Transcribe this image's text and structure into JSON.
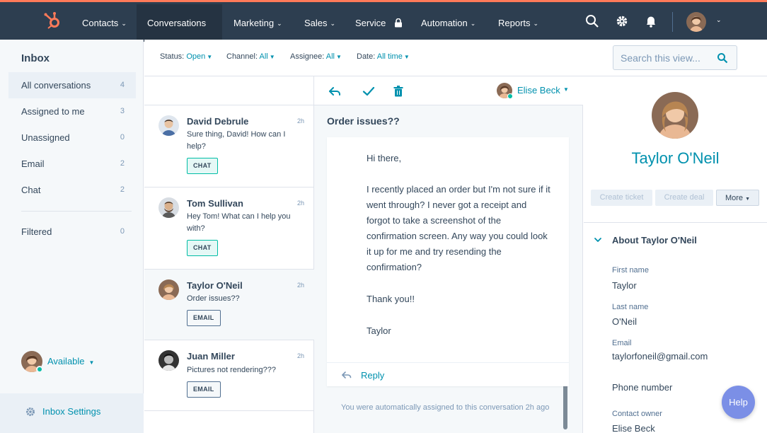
{
  "nav": {
    "items": [
      {
        "label": "Contacts",
        "has_chevron": true
      },
      {
        "label": "Conversations",
        "has_chevron": true,
        "active": true
      },
      {
        "label": "Marketing",
        "has_chevron": true
      },
      {
        "label": "Sales",
        "has_chevron": true
      },
      {
        "label": "Service",
        "locked": true
      },
      {
        "label": "Automation",
        "has_chevron": true
      },
      {
        "label": "Reports",
        "has_chevron": true
      }
    ],
    "icons": [
      "search-icon",
      "gear-icon",
      "bell-icon"
    ],
    "accent": "#ff7a59",
    "background": "#2d3e50"
  },
  "sidebar": {
    "title": "Inbox",
    "items": [
      {
        "label": "All conversations",
        "count": "4",
        "active": true
      },
      {
        "label": "Assigned to me",
        "count": "3"
      },
      {
        "label": "Unassigned",
        "count": "0"
      },
      {
        "label": "Email",
        "count": "2"
      },
      {
        "label": "Chat",
        "count": "2"
      },
      {
        "label": "Filtered",
        "count": "0"
      }
    ],
    "availability": "Available",
    "settings_label": "Inbox Settings"
  },
  "filters": {
    "status": {
      "label": "Status:",
      "value": "Open"
    },
    "channel": {
      "label": "Channel:",
      "value": "All"
    },
    "assignee": {
      "label": "Assignee:",
      "value": "All"
    },
    "date": {
      "label": "Date:",
      "value": "All time"
    },
    "search_placeholder": "Search this view..."
  },
  "conversations": [
    {
      "name": "David Debrule",
      "time": "2h",
      "preview": "Sure thing, David! How can I help?",
      "channel": "CHAT"
    },
    {
      "name": "Tom Sullivan",
      "time": "2h",
      "preview": "Hey Tom! What can I help you with?",
      "channel": "CHAT"
    },
    {
      "name": "Taylor O'Neil",
      "time": "2h",
      "preview": "Order issues??",
      "channel": "EMAIL",
      "active": true
    },
    {
      "name": "Juan Miller",
      "time": "2h",
      "preview": "Pictures not rendering???",
      "channel": "EMAIL"
    }
  ],
  "thread": {
    "agent_name": "Elise Beck",
    "subject": "Order issues??",
    "message_lines": [
      "Hi there,",
      "I recently placed an order but I'm not sure if it",
      "went through? I never got a receipt and",
      "forgot to take a screenshot of the",
      "confirmation screen. Any way you could look",
      "it up for me and try resending the",
      "confirmation?",
      "Thank you!!",
      "Taylor"
    ],
    "reply_label": "Reply",
    "assigned_note": "You were automatically assigned to this conversation 2h ago"
  },
  "contact": {
    "name": "Taylor O'Neil",
    "buttons": {
      "create_ticket": "Create ticket",
      "create_deal": "Create deal",
      "more": "More"
    },
    "about_title": "About Taylor O'Neil",
    "properties": [
      {
        "label": "First name",
        "value": "Taylor"
      },
      {
        "label": "Last name",
        "value": "O'Neil"
      },
      {
        "label": "Email",
        "value": "taylorfoneil@gmail.com"
      },
      {
        "label": "Phone number",
        "value": ""
      },
      {
        "label": "Contact owner",
        "value": "Elise Beck"
      }
    ]
  },
  "help_label": "Help"
}
